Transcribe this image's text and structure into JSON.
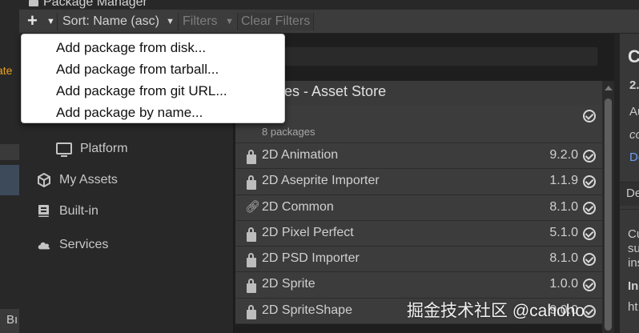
{
  "window": {
    "title": "Package Manager"
  },
  "underlay": {
    "orange_text": "ate",
    "bottom_tab": "Bı"
  },
  "toolbar": {
    "add_icon": "plus-icon",
    "sort_label": "Sort: Name (asc)",
    "filters_label": "Filters",
    "clear_filters_label": "Clear Filters"
  },
  "add_menu": {
    "items": [
      {
        "label": "Add package from disk..."
      },
      {
        "label": "Add package from tarball..."
      },
      {
        "label": "Add package from git URL..."
      },
      {
        "label": "Add package by name..."
      }
    ]
  },
  "sidebar": {
    "items": [
      {
        "label": "Platform",
        "icon": "monitor-icon"
      },
      {
        "label": "My Assets",
        "icon": "box-icon"
      },
      {
        "label": "Built-in",
        "icon": "library-icon"
      },
      {
        "label": "Services",
        "icon": "cloud-icon"
      }
    ]
  },
  "list": {
    "header": "kages - Asset Store",
    "group_count": "8 packages",
    "packages": [
      {
        "name": "2D Animation",
        "version": "9.2.0",
        "icon": "lock-icon"
      },
      {
        "name": "2D Aseprite Importer",
        "version": "1.1.9",
        "icon": "lock-icon"
      },
      {
        "name": "2D Common",
        "version": "8.1.0",
        "icon": "link-icon"
      },
      {
        "name": "2D Pixel Perfect",
        "version": "5.1.0",
        "icon": "lock-icon"
      },
      {
        "name": "2D PSD Importer",
        "version": "8.1.0",
        "icon": "lock-icon"
      },
      {
        "name": "2D Sprite",
        "version": "1.0.0",
        "icon": "lock-icon"
      },
      {
        "name": "2D SpriteShape",
        "version": "9.0.0",
        "icon": "lock-icon"
      }
    ]
  },
  "detail": {
    "title": "C",
    "version": "2.",
    "author": "Au",
    "company": "co",
    "link": "De",
    "tab": "De",
    "description": "Cu\nsu\nins",
    "section": "In",
    "more": "ht"
  },
  "watermark": "掘金技术社区 @cahoho"
}
